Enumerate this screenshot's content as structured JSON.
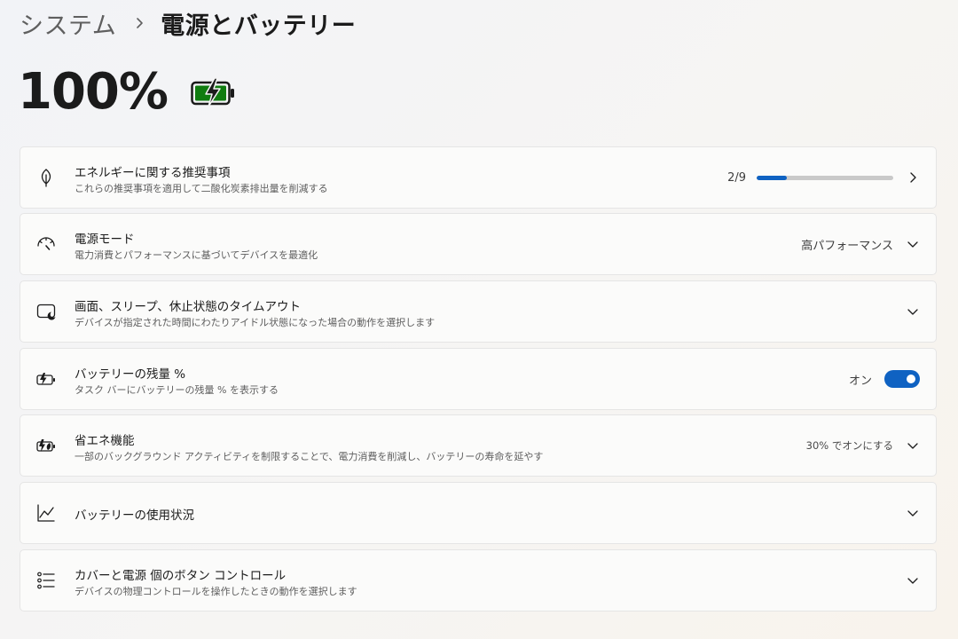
{
  "breadcrumb": {
    "parent": "システム",
    "current": "電源とバッテリー"
  },
  "battery": {
    "percent_label": "100%",
    "level": 1.0,
    "icon": "battery-charging-icon",
    "fill_color": "#107c10"
  },
  "accent_color": "#0f62c2",
  "cards": {
    "energy": {
      "icon": "leaf-icon",
      "title": "エネルギーに関する推奨事項",
      "subtitle": "これらの推奨事項を適用して二酸化炭素排出量を削減する",
      "progress_label": "2/9",
      "progress_value": 2,
      "progress_max": 9
    },
    "power_mode": {
      "icon": "speedometer-icon",
      "title": "電源モード",
      "subtitle": "電力消費とパフォーマンスに基づいてデバイスを最適化",
      "value": "高パフォーマンス"
    },
    "timeout": {
      "icon": "screen-sleep-icon",
      "title": "画面、スリープ、休止状態のタイムアウト",
      "subtitle": "デバイスが指定された時間にわたりアイドル状態になった場合の動作を選択します"
    },
    "battery_percent": {
      "icon": "battery-small-icon",
      "title": "バッテリーの残量 %",
      "subtitle": "タスク バーにバッテリーの残量 % を表示する",
      "toggle_label": "オン",
      "toggle_on": true
    },
    "saver": {
      "icon": "battery-saver-icon",
      "title": "省エネ機能",
      "subtitle": "一部のバックグラウンド アクティビティを制限することで、電力消費を削減し、バッテリーの寿命を延やす",
      "value": "30% でオンにする"
    },
    "usage": {
      "icon": "line-chart-icon",
      "title": "バッテリーの使用状況"
    },
    "lid": {
      "icon": "list-controls-icon",
      "title": "カバーと電源 個のボタン コントロール",
      "subtitle": "デバイスの物理コントロールを操作したときの動作を選択します"
    }
  }
}
